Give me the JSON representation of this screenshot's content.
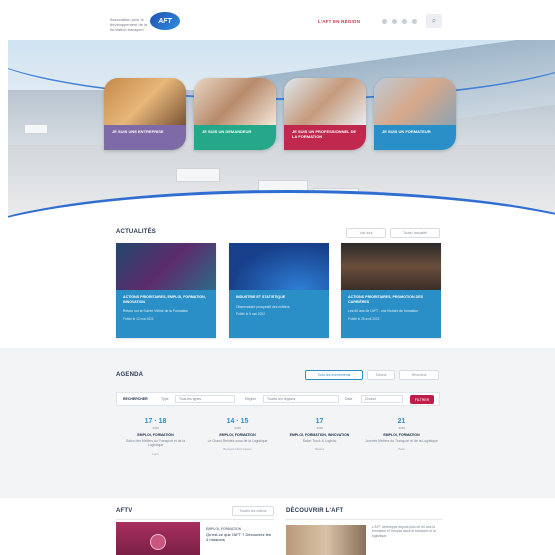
{
  "header": {
    "logo_text": "AFT",
    "cta_label": "L'AFT EN RÉGION",
    "search_icon": "search-icon"
  },
  "hero": {
    "cards": [
      {
        "label": "JE SUIS UNE ENTREPRISE",
        "color": "#7d6aa6"
      },
      {
        "label": "JE SUIS UN DEMANDEUR",
        "color": "#25a889"
      },
      {
        "label": "JE SUIS UN PROFESSIONNEL DE LA FORMATION",
        "color": "#c0284e"
      },
      {
        "label": "JE SUIS UN FORMATEUR",
        "color": "#2a8fc6"
      }
    ]
  },
  "actualites": {
    "title": "ACTUALITÉS",
    "btn1": "Voir tout",
    "btn2": "Toute l'actualité",
    "items": [
      {
        "category": "ACTIONS PRIORITAIRES, EMPLOI, FORMATION, INNOVATION",
        "text": "Retour sur la Soirée Vitrine de la Formation",
        "date": "Publié le 12 mai 2022"
      },
      {
        "category": "INDUSTRIE ET STATISTIQUE",
        "text": "Observatoire prospectif des métiers",
        "date": "Publié le 5 mai 2022"
      },
      {
        "category": "ACTIONS PRIORITAIRES, PROMOTION DES CARRIÈRES",
        "text": "Les 60 ans de l'AFT : une histoire de formation",
        "date": "Publié le 28 avril 2022"
      }
    ]
  },
  "agenda": {
    "title": "AGENDA",
    "tabs": [
      "Tous les événements",
      "Salons",
      "Réunions"
    ],
    "filter_label": "RECHERCHER",
    "filter_type": "Type",
    "filter_type_value": "Tous les types",
    "filter_region": "Région",
    "filter_region_value": "Toutes les régions",
    "filter_date": "Date",
    "filter_date_value": "Choisir",
    "filter_btn": "FILTRER",
    "events": [
      {
        "day1": "17",
        "day2": "18",
        "month": "JUIN",
        "category": "EMPLOI, FORMATION",
        "text": "Salon des Métiers du Transport et de la Logistique",
        "location": "Lyon"
      },
      {
        "day1": "14",
        "day2": "15",
        "month": "JUIN",
        "category": "EMPLOI, FORMATION",
        "text": "Le Grand Rendez-vous de la Logistique",
        "location": "Bourges Nord Centre"
      },
      {
        "day1": "17",
        "day2": "",
        "month": "JUIN",
        "category": "EMPLOI, FORMATION, INNOVATION",
        "text": "Salon Truck & Logistic",
        "location": "Nantes"
      },
      {
        "day1": "21",
        "day2": "",
        "month": "JUIN",
        "category": "EMPLOI, FORMATION",
        "text": "Journée Métiers du Transport et de la Logistique",
        "location": "Paris"
      }
    ]
  },
  "afttv": {
    "title": "AFTV",
    "btn": "Toutes les vidéos",
    "side_category": "EMPLOI, FORMATION",
    "side_text": "Qu'est-ce que l'AFT ? Découvrez les 4 missions"
  },
  "decouvrir": {
    "title": "DÉCOUVRIR L'AFT",
    "text": "L'AFT développe depuis plus de 60 ans la formation et l'emploi dans le transport et la logistique."
  },
  "colors": {
    "accent_red": "#c01e4a",
    "accent_blue": "#2a8fc6"
  }
}
